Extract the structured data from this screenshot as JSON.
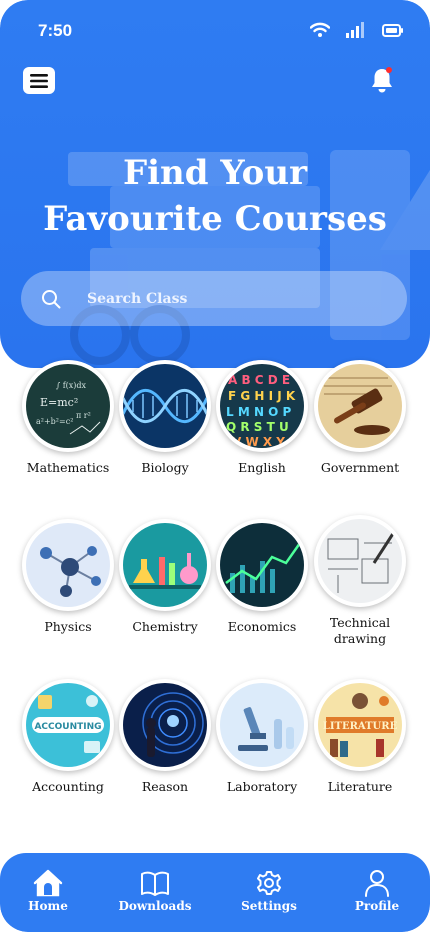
{
  "status_bar": {
    "time": "7:50"
  },
  "hero": {
    "title_line1": "Find Your",
    "title_line2": "Favourite Courses",
    "search_placeholder": "Search Class"
  },
  "courses": [
    {
      "label": "Mathematics",
      "icon": "chalkboard-equations"
    },
    {
      "label": "Biology",
      "icon": "dna-helix"
    },
    {
      "label": "English",
      "icon": "alphabet-letters"
    },
    {
      "label": "Government",
      "icon": "gavel-constitution"
    },
    {
      "label": "Physics",
      "icon": "atom-model"
    },
    {
      "label": "Chemistry",
      "icon": "lab-flasks"
    },
    {
      "label": "Economics",
      "icon": "market-chart"
    },
    {
      "label": "Technical",
      "label_line2": "drawing",
      "icon": "blueprint-pen"
    },
    {
      "label": "Accounting",
      "icon": "accounting-badge"
    },
    {
      "label": "Reason",
      "icon": "lightbulb-maze"
    },
    {
      "label": "Laboratory",
      "icon": "microscope"
    },
    {
      "label": "Literature",
      "icon": "literature-books"
    }
  ],
  "bottom_nav": [
    {
      "label": "Home",
      "icon": "home-icon"
    },
    {
      "label": "Downloads",
      "icon": "book-icon"
    },
    {
      "label": "Settings",
      "icon": "gear-icon"
    },
    {
      "label": "Profile",
      "icon": "user-icon"
    }
  ],
  "colors": {
    "primary": "#2f7cf2",
    "surface": "#ffffff",
    "text": "#111111"
  }
}
